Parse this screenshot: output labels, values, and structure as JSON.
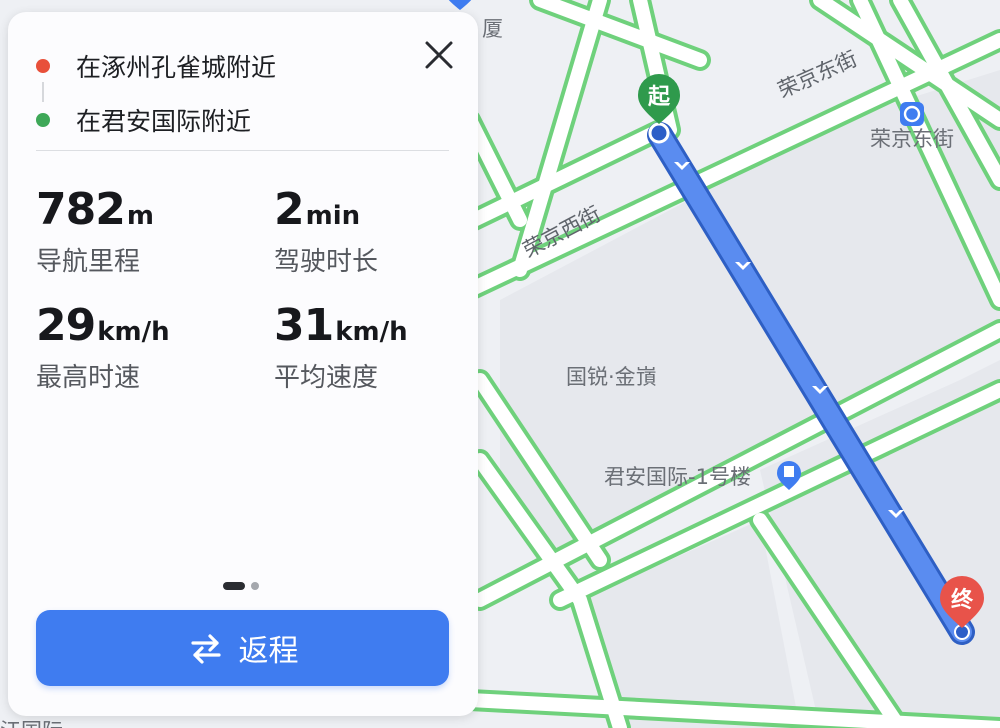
{
  "route": {
    "origin": "在涿州孔雀城附近",
    "destination": "在君安国际附近"
  },
  "stats": [
    {
      "value": "782",
      "unit": "m",
      "label": "导航里程"
    },
    {
      "value": "2",
      "unit": "min",
      "label": "驾驶时长"
    },
    {
      "value": "29",
      "unit": "km/h",
      "label": "最高时速"
    },
    {
      "value": "31",
      "unit": "km/h",
      "label": "平均速度"
    }
  ],
  "pager": {
    "pages": 2,
    "current": 1
  },
  "return_button": {
    "label": "返程",
    "icon": "swap-arrows-icon"
  },
  "close_icon": "close-icon",
  "map": {
    "streets": {
      "rongjing_east": "荣京东街",
      "rongjing_west": "荣京西街"
    },
    "pois": {
      "metro": "荣京东街",
      "building": "国锐·金嵿",
      "junan": "君安国际-1号楼",
      "top_fragment": "厦",
      "bottom_fragment": "江国际"
    },
    "markers": {
      "start": "起",
      "end": "终"
    }
  },
  "colors": {
    "accent": "#3f7cf0",
    "route": "#5a8cf0",
    "road_traffic": "#6fd17c",
    "origin_dot": "#e8503a",
    "destination_dot": "#3ea858",
    "start_marker": "#2f9a4c",
    "end_marker": "#e8534a"
  }
}
